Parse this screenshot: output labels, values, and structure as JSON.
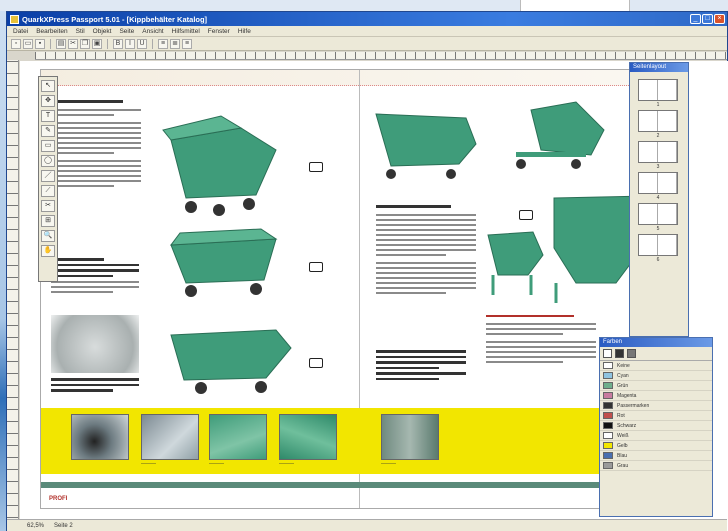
{
  "window": {
    "title": "QuarkXPress Passport 5.01 - [Kippbehälter Katalog]",
    "minimize": "_",
    "maximize": "□",
    "close": "×"
  },
  "menu": [
    "Datei",
    "Bearbeiten",
    "Stil",
    "Objekt",
    "Seite",
    "Ansicht",
    "Hilfsmittel",
    "Fenster",
    "Hilfe"
  ],
  "colors": {
    "hopper_green": "#3f9c7a",
    "yellow_band": "#f2e600",
    "footer_teal": "#5a8a7a",
    "heading_red": "#b2302a"
  },
  "spread": {
    "footer_logo": "PROFI"
  },
  "pages_palette": {
    "title": "Seitenlayout",
    "pages": [
      "1",
      "2",
      "3",
      "4",
      "5",
      "6"
    ]
  },
  "colors_palette": {
    "title": "Farben",
    "swatches": [
      {
        "name": "Keine",
        "color": "#ffffff"
      },
      {
        "name": "Cyan",
        "color": "#8fc3e0"
      },
      {
        "name": "Grün",
        "color": "#6fae8c"
      },
      {
        "name": "Magenta",
        "color": "#c77b9f"
      },
      {
        "name": "Passermarken",
        "color": "#333333"
      },
      {
        "name": "Rot",
        "color": "#c0504d"
      },
      {
        "name": "Schwarz",
        "color": "#111111"
      },
      {
        "name": "Weiß",
        "color": "#ffffff"
      },
      {
        "name": "Gelb",
        "color": "#f2e600"
      },
      {
        "name": "Blau",
        "color": "#4a6fb0"
      },
      {
        "name": "Grau",
        "color": "#9a9a9a"
      }
    ]
  },
  "statusbar": {
    "zoom": "62,5%",
    "page": "Seite 2"
  },
  "toolbox": {
    "tools": [
      "↖",
      "✥",
      "T",
      "✎",
      "▭",
      "◯",
      "／",
      "⟋",
      "✂",
      "⊞",
      "🔍",
      "✋"
    ]
  }
}
